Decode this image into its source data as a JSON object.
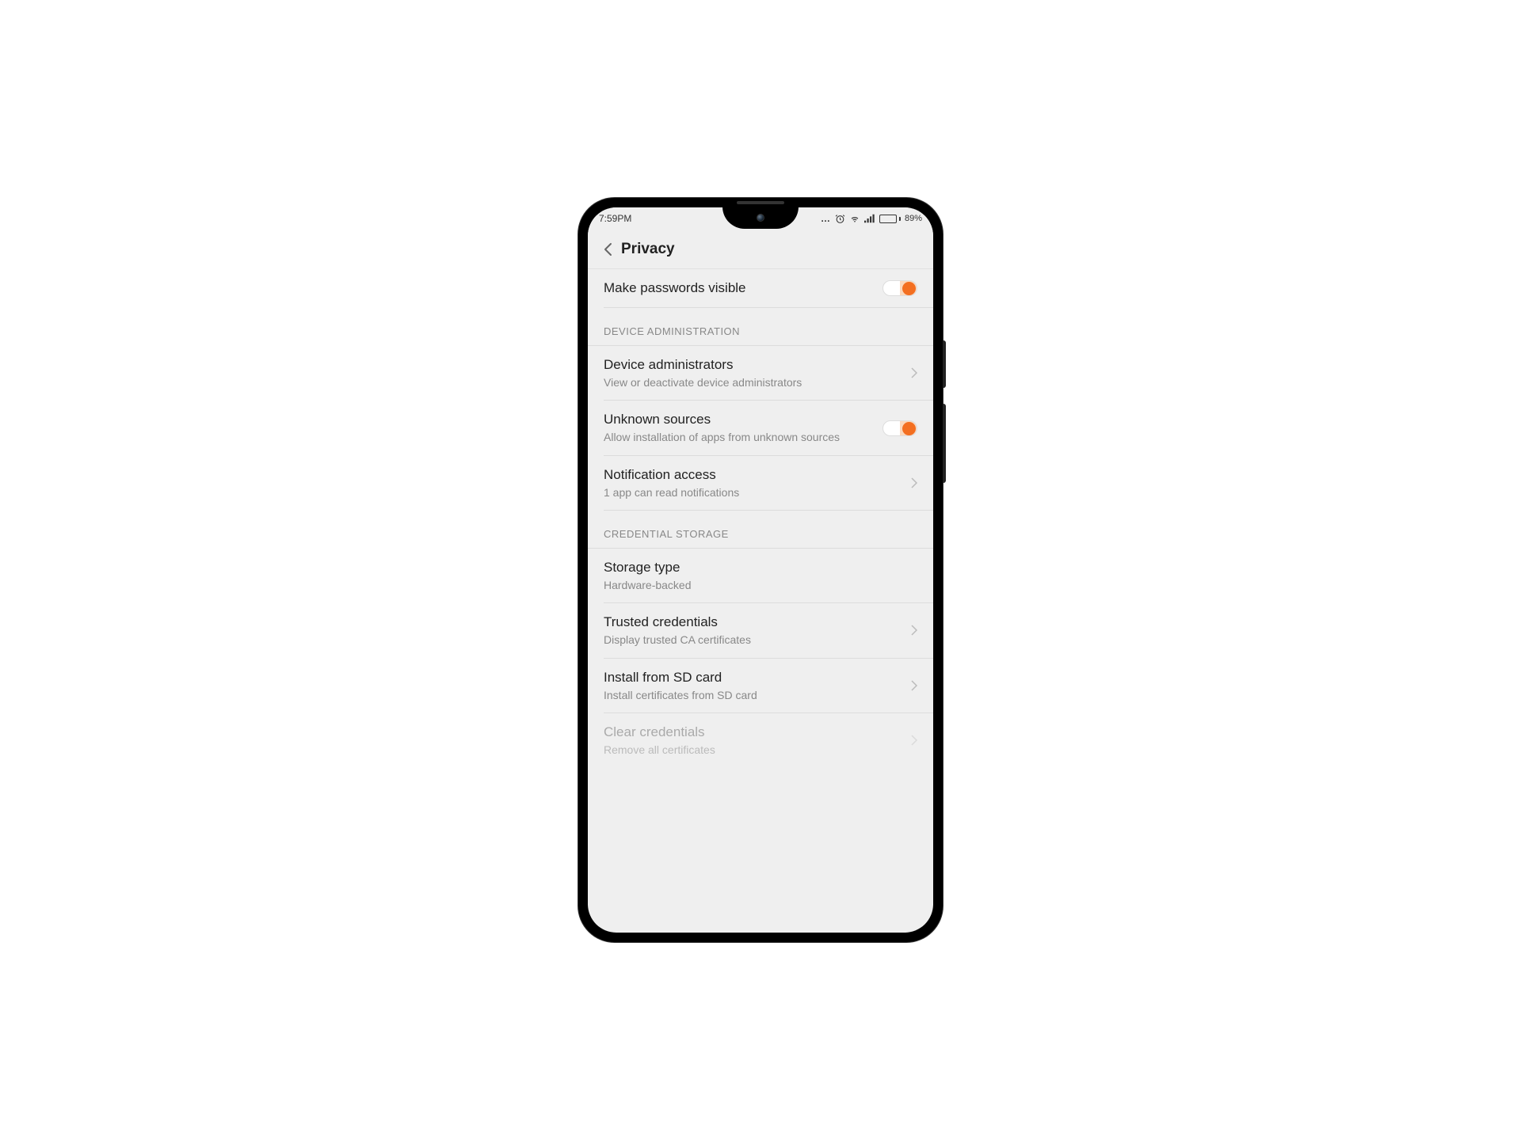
{
  "status": {
    "time": "7:59PM",
    "battery_pct": "89%",
    "battery_fill_pct": 89
  },
  "header": {
    "title": "Privacy"
  },
  "rows": {
    "passwords": {
      "title": "Make passwords visible"
    },
    "section_device_admin": "DEVICE ADMINISTRATION",
    "device_admins": {
      "title": "Device administrators",
      "sub": "View or deactivate device administrators"
    },
    "unknown_sources": {
      "title": "Unknown sources",
      "sub": "Allow installation of apps from unknown sources"
    },
    "notification_access": {
      "title": "Notification access",
      "sub": "1 app can read notifications"
    },
    "section_cred_storage": "CREDENTIAL STORAGE",
    "storage_type": {
      "title": "Storage type",
      "sub": "Hardware-backed"
    },
    "trusted_credentials": {
      "title": "Trusted credentials",
      "sub": "Display trusted CA certificates"
    },
    "install_sd": {
      "title": "Install from SD card",
      "sub": "Install certificates from SD card"
    },
    "clear_credentials": {
      "title": "Clear credentials",
      "sub": "Remove all certificates"
    }
  },
  "toggles": {
    "passwords_visible": true,
    "unknown_sources": true
  }
}
